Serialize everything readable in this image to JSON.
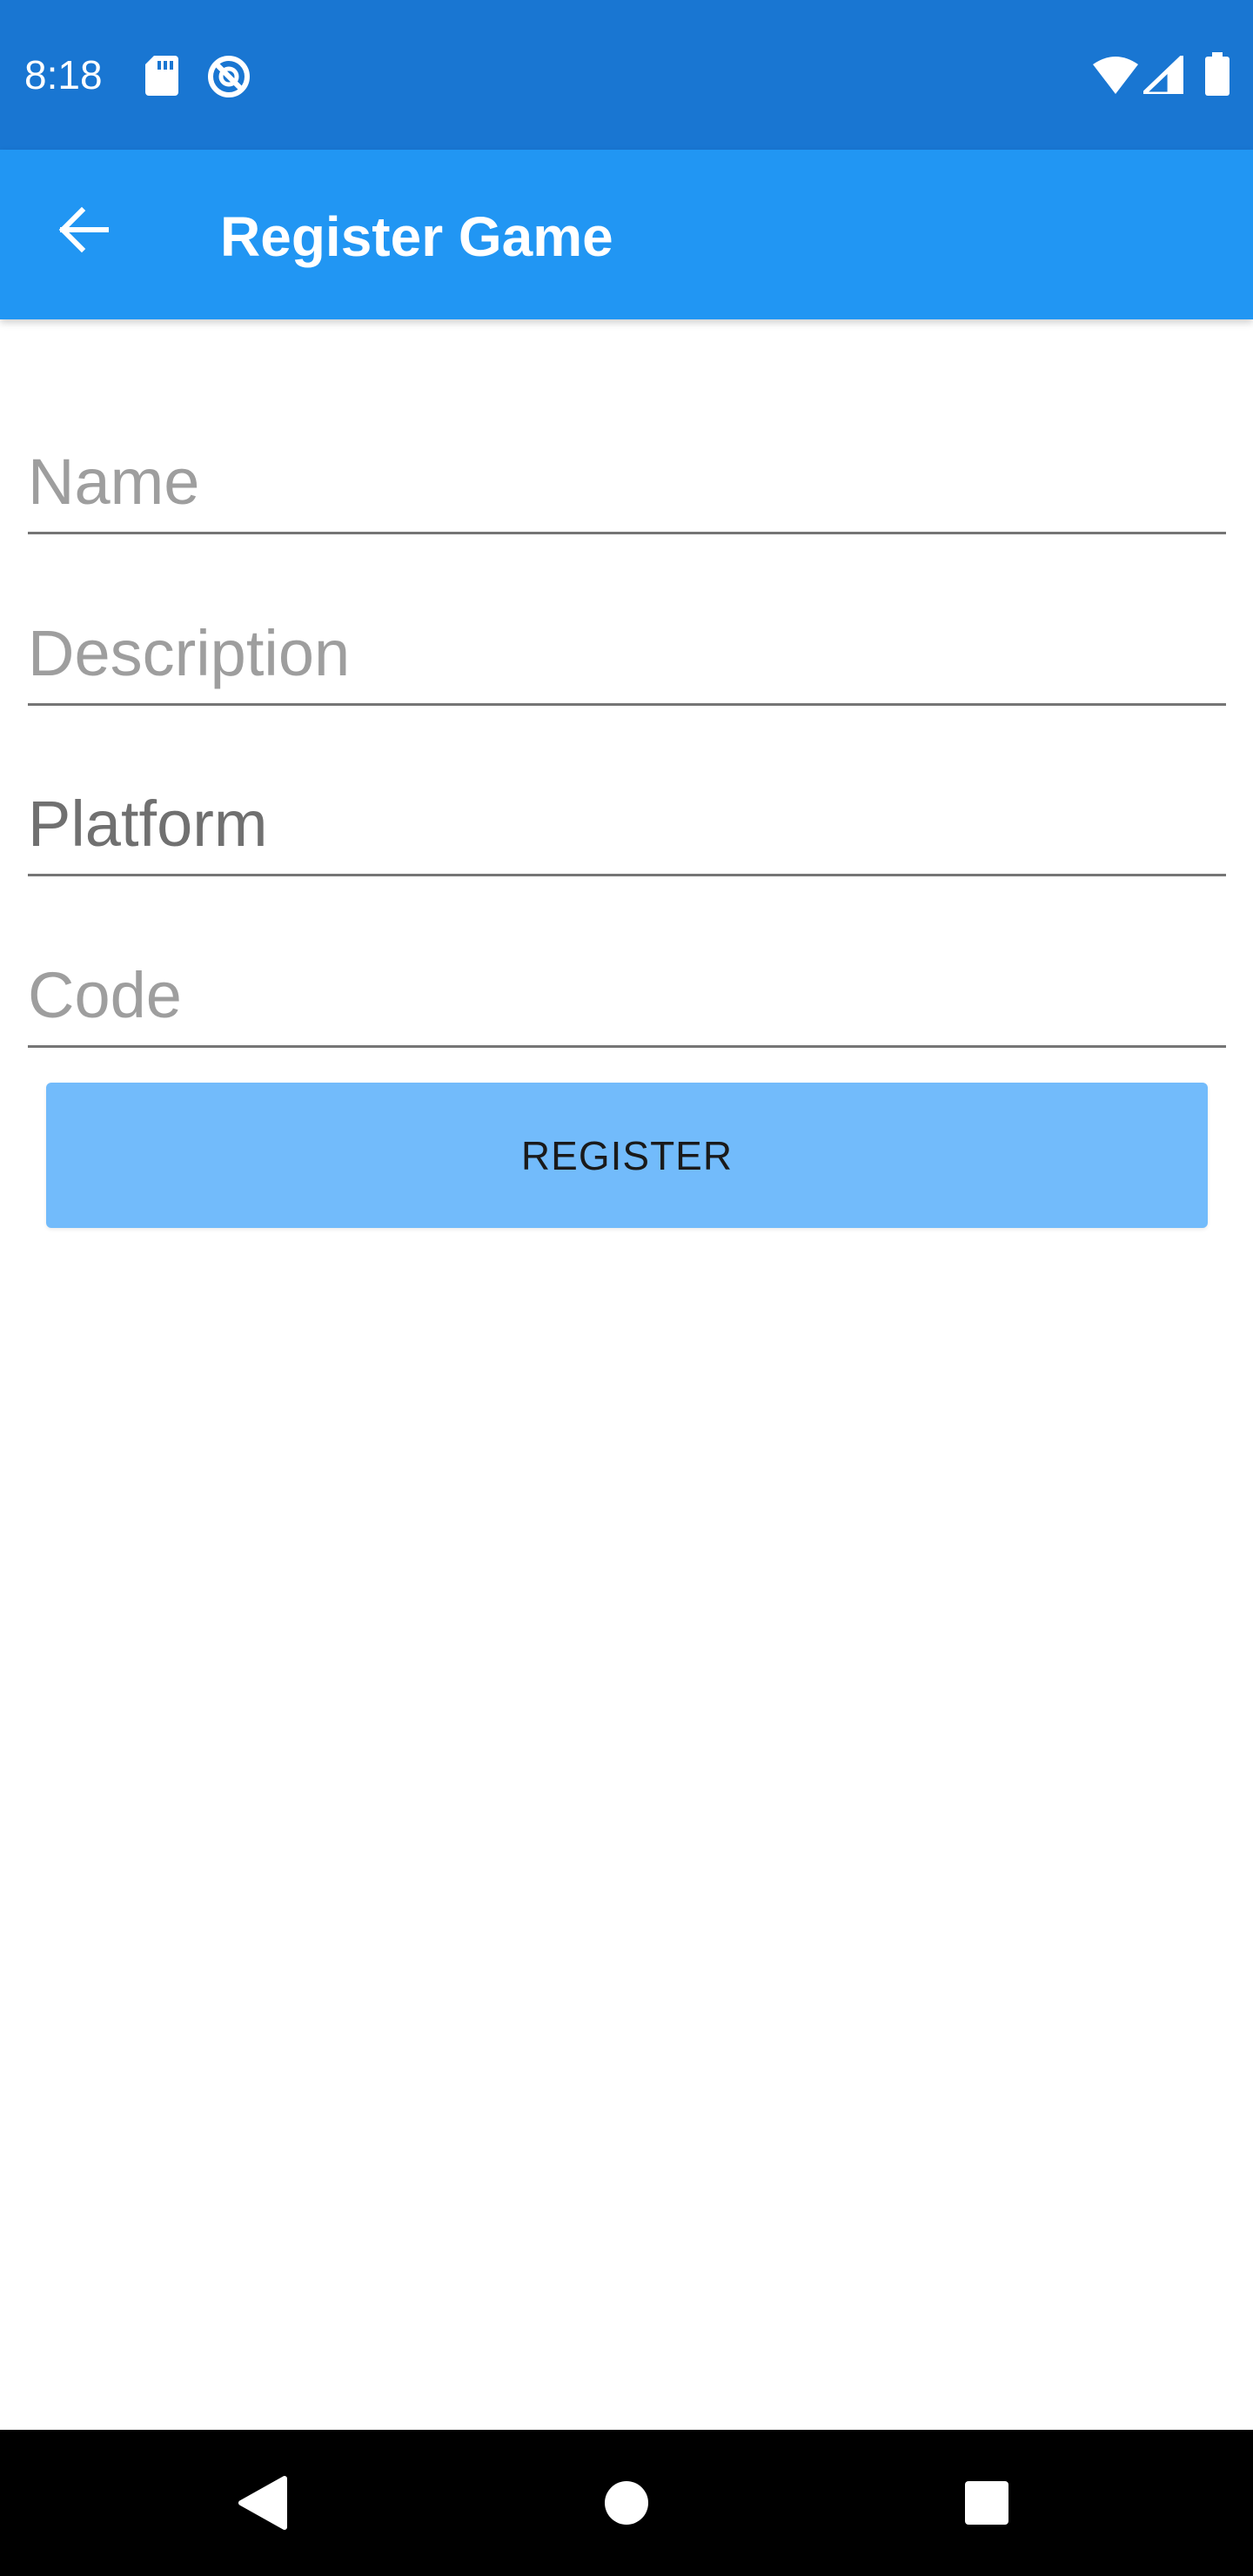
{
  "status_bar": {
    "time": "8:18",
    "left_icons": [
      "sd-card-icon",
      "do-not-disturb-icon"
    ],
    "right_icons": [
      "wifi-icon",
      "cellular-signal-icon",
      "battery-icon"
    ]
  },
  "app_bar": {
    "back_icon": "arrow-left-icon",
    "title": "Register Game"
  },
  "form": {
    "name": {
      "placeholder": "Name",
      "value": ""
    },
    "description": {
      "placeholder": "Description",
      "value": ""
    },
    "platform": {
      "placeholder": "Platform",
      "value": ""
    },
    "code": {
      "placeholder": "Code",
      "value": ""
    },
    "register_label": "REGISTER"
  },
  "nav_bar": {
    "buttons": [
      "back-triangle-icon",
      "home-circle-icon",
      "recents-square-icon"
    ]
  },
  "colors": {
    "status_bar": "#1976d2",
    "app_bar": "#2196f3",
    "button": "#72bbfb"
  }
}
